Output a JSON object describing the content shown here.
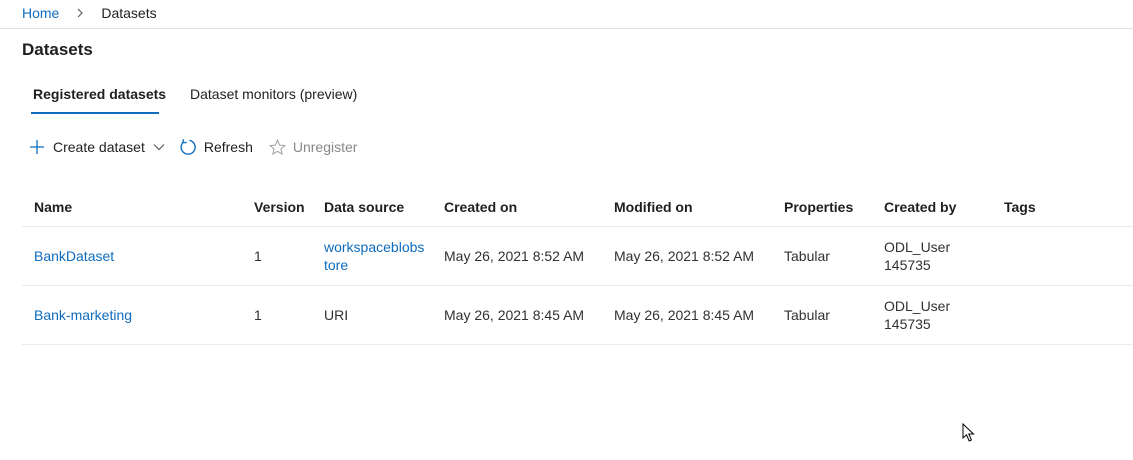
{
  "breadcrumb": {
    "home": "Home",
    "current": "Datasets"
  },
  "page": {
    "title": "Datasets"
  },
  "tabs": [
    {
      "label": "Registered datasets",
      "active": true
    },
    {
      "label": "Dataset monitors (preview)",
      "active": false
    }
  ],
  "toolbar": {
    "create_label": "Create dataset",
    "refresh_label": "Refresh",
    "unregister_label": "Unregister"
  },
  "table": {
    "columns": [
      "Name",
      "Version",
      "Data source",
      "Created on",
      "Modified on",
      "Properties",
      "Created by",
      "Tags"
    ],
    "rows": [
      {
        "name": "BankDataset",
        "version": "1",
        "data_source_line1": "workspaceblobs",
        "data_source_line2": "tore",
        "created_on": "May 26, 2021 8:52 AM",
        "modified_on": "May 26, 2021 8:52 AM",
        "properties": "Tabular",
        "created_by_line1": "ODL_User",
        "created_by_line2": "145735",
        "tags": ""
      },
      {
        "name": "Bank-marketing",
        "version": "1",
        "data_source": "URI",
        "created_on": "May 26, 2021 8:45 AM",
        "modified_on": "May 26, 2021 8:45 AM",
        "properties": "Tabular",
        "created_by_line1": "ODL_User",
        "created_by_line2": "145735",
        "tags": ""
      }
    ]
  },
  "colors": {
    "link": "#0f6cbd",
    "text": "#201f1e",
    "disabled": "#8a8886",
    "divider": "#edebe9"
  },
  "icons": [
    "chevron-right-icon",
    "plus-icon",
    "chevron-down-icon",
    "refresh-icon",
    "star-icon",
    "mouse-cursor-icon"
  ]
}
